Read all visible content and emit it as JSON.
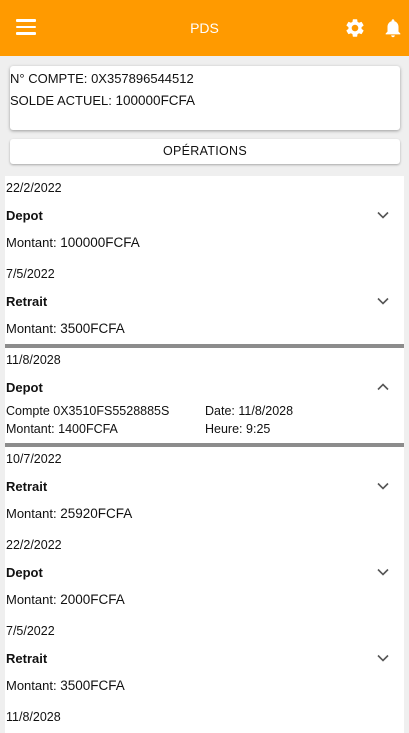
{
  "appbar": {
    "title": "PDS",
    "color": "#ff9a00",
    "icons": [
      "menu-icon",
      "gear-icon",
      "bell-icon"
    ]
  },
  "account": {
    "number_label": "N° COMPTE:",
    "number_value": "0X357896544512",
    "balance_label": "SOLDE ACTUEL:",
    "balance_value": "100000",
    "currency": "FCFA"
  },
  "operations_button": "OPÉRATIONS",
  "transactions": [
    {
      "date": "22/2/2022",
      "type": "Depot",
      "amount_label": "Montant:",
      "amount": "100000",
      "currency": "FCFA",
      "expanded": false
    },
    {
      "date": "7/5/2022",
      "type": "Retrait",
      "amount_label": "Montant:",
      "amount": "3500",
      "currency": "FCFA",
      "expanded": false
    },
    {
      "date": "11/8/2028",
      "type": "Depot",
      "expanded": true,
      "account_label": "Compte",
      "account_value": "0X3510FS5528885S",
      "amount_label": "Montant:",
      "amount": "1400",
      "currency": "FCFA",
      "date_label": "Date:",
      "date_value": "11/8/2028",
      "time_label": "Heure:",
      "time_value": "9:25"
    },
    {
      "date": "10/7/2022",
      "type": "Retrait",
      "amount_label": "Montant:",
      "amount": "25920",
      "currency": "FCFA",
      "expanded": false
    },
    {
      "date": "22/2/2022",
      "type": "Depot",
      "amount_label": "Montant:",
      "amount": "2000",
      "currency": "FCFA",
      "expanded": false
    },
    {
      "date": "7/5/2022",
      "type": "Retrait",
      "amount_label": "Montant:",
      "amount": "3500",
      "currency": "FCFA",
      "expanded": false
    },
    {
      "date": "11/8/2028",
      "partial": true
    }
  ]
}
